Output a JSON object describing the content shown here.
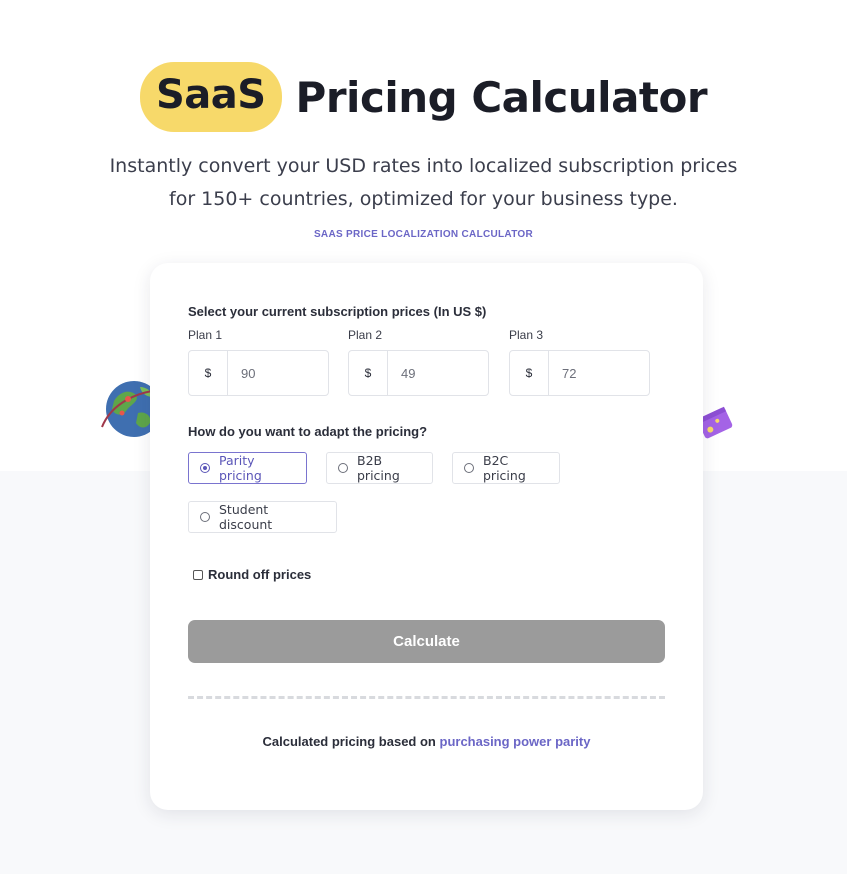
{
  "hero": {
    "title_highlight": "SaaS",
    "title_rest": "Pricing Calculator",
    "subtitle_line1": "Instantly convert your USD rates into localized subscription prices",
    "subtitle_line2": "for 150+ countries, optimized for your business type.",
    "eyebrow": "SAAS PRICE LOCALIZATION CALCULATOR"
  },
  "form": {
    "prices_label": "Select your current subscription prices (In US $)",
    "plans": [
      {
        "label": "Plan 1",
        "currency": "$",
        "value": "90"
      },
      {
        "label": "Plan 2",
        "currency": "$",
        "value": "49"
      },
      {
        "label": "Plan 3",
        "currency": "$",
        "value": "72"
      }
    ],
    "adapt_label": "How do you want to adapt the pricing?",
    "options": [
      {
        "label": "Parity pricing",
        "selected": true
      },
      {
        "label": "B2B pricing",
        "selected": false
      },
      {
        "label": "B2C pricing",
        "selected": false
      },
      {
        "label": "Student discount",
        "selected": false
      }
    ],
    "round_off_label": "Round off prices",
    "round_off_checked": false,
    "calculate_label": "Calculate"
  },
  "footer": {
    "prefix": "Calculated pricing based on",
    "link": "purchasing power parity"
  },
  "colors": {
    "badge": "#f7d96a",
    "accent": "#6b66c6",
    "button": "#9b9b9b"
  },
  "icons": [
    "globe-illustration",
    "ticket-illustration"
  ]
}
